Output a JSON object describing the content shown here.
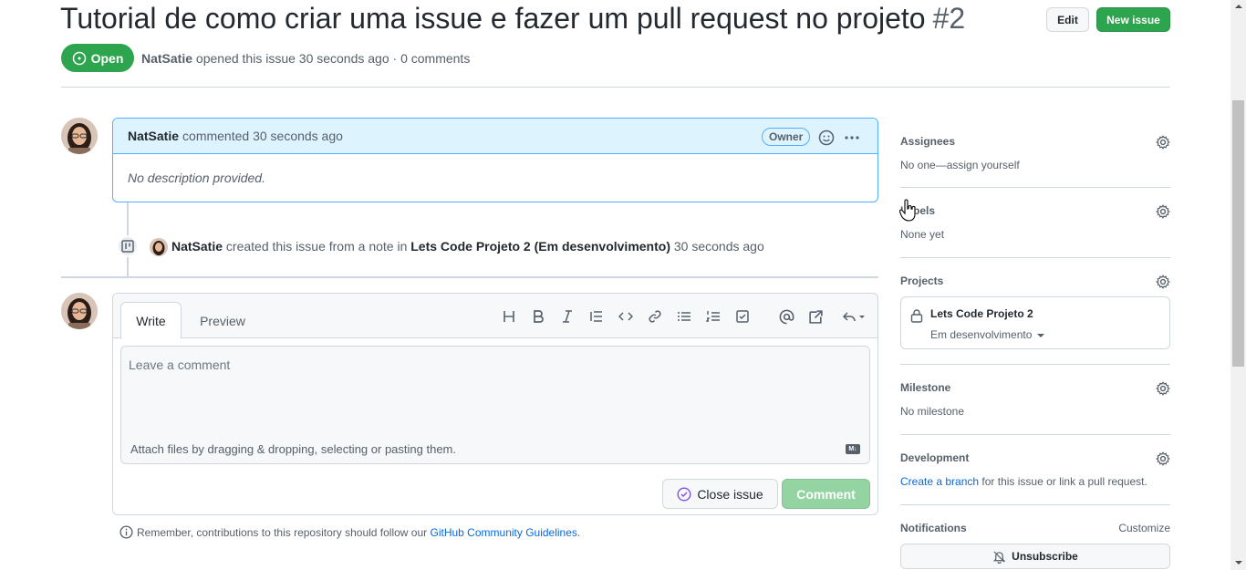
{
  "issue": {
    "title": "Tutorial de como criar uma issue e fazer um pull request no projeto",
    "number": "#2",
    "state": "Open",
    "author": "NatSatie",
    "meta_rest": "opened this issue 30 seconds ago · 0 comments"
  },
  "header_buttons": {
    "edit": "Edit",
    "new_issue": "New issue"
  },
  "comment": {
    "author": "NatSatie",
    "action": "commented 30 seconds ago",
    "badge": "Owner",
    "body": "No description provided."
  },
  "event": {
    "author": "NatSatie",
    "text1": "created this issue from a note in",
    "project": "Lets Code Projeto 2",
    "column": "(Em desenvolvimento)",
    "time": "30 seconds ago"
  },
  "editor": {
    "tabs": [
      "Write",
      "Preview"
    ],
    "placeholder": "Leave a comment",
    "attach_text": "Attach files by dragging & dropping, selecting or pasting them.",
    "md_badge": "M↓",
    "close_label": "Close issue",
    "comment_label": "Comment"
  },
  "toolbar_icons": [
    "heading-icon",
    "bold-icon",
    "italic-icon",
    "quote-icon",
    "code-icon",
    "link-icon",
    "bulleted-list-icon",
    "numbered-list-icon",
    "task-list-icon",
    "mention-icon",
    "cross-reference-icon",
    "saved-replies-icon"
  ],
  "remember": {
    "text": "Remember, contributions to this repository should follow our",
    "link": "GitHub Community Guidelines",
    "end": "."
  },
  "sidebar": {
    "assignees": {
      "title": "Assignees",
      "value": "No one—assign yourself"
    },
    "labels": {
      "title": "Labels",
      "value": "None yet"
    },
    "projects": {
      "title": "Projects",
      "name": "Lets Code Projeto 2",
      "column": "Em desenvolvimento"
    },
    "milestone": {
      "title": "Milestone",
      "value": "No milestone"
    },
    "development": {
      "title": "Development",
      "link": "Create a branch",
      "rest": "for this issue or link a pull request."
    },
    "notifications": {
      "title": "Notifications",
      "customize": "Customize",
      "unsubscribe": "Unsubscribe"
    }
  },
  "colors": {
    "green": "#2da44e",
    "blue_link": "#0969da",
    "comment_head_bg": "#ddf4ff"
  }
}
